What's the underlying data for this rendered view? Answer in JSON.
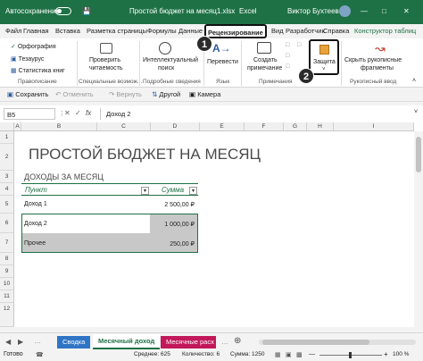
{
  "titlebar": {
    "autosave": "Автосохранение",
    "filename": "Простой бюджет на месяц1.xlsx",
    "app": "Excel",
    "user": "Виктор Бухтеев"
  },
  "tabs": [
    "Файл",
    "Главная",
    "Вставка",
    "Разметка страницы",
    "Формулы",
    "Данные",
    "Рецензирование",
    "Вид",
    "Разработчик",
    "Справка",
    "Конструктор таблиц"
  ],
  "ribbon": {
    "spelling": "Орфография",
    "thesaurus": "Тезаурус",
    "stats": "Статистика книг",
    "group_proofing": "Правописание",
    "check_access_1": "Проверить",
    "check_access_2": "читаемость",
    "group_access": "Специальные возмож...",
    "smart_lookup_1": "Интеллектуальный",
    "smart_lookup_2": "поиск",
    "group_insights": "Подробные сведения",
    "translate": "Перевести",
    "group_language": "Язык",
    "new_comment_1": "Создать",
    "new_comment_2": "примечание",
    "group_comments": "Примечания",
    "protect": "Защита",
    "hide_ink_1": "Скрыть рукописные",
    "hide_ink_2": "фрагменты",
    "group_ink": "Рукописный ввод"
  },
  "quick_access": {
    "save": "Сохранить",
    "undo": "Отменить",
    "redo": "Вернуть",
    "sort": "Другой",
    "camera": "Камера"
  },
  "formula_bar": {
    "name_box": "B5",
    "fx": "fx",
    "content": "Доход 2"
  },
  "columns": [
    "A",
    "B",
    "C",
    "D",
    "E",
    "F",
    "G",
    "H",
    "I"
  ],
  "rows": [
    "1",
    "2",
    "3",
    "4",
    "5",
    "6",
    "7",
    "8",
    "9",
    "10",
    "11",
    "12"
  ],
  "sheet": {
    "title": "ПРОСТОЙ БЮДЖЕТ НА МЕСЯЦ",
    "subtitle": "ДОХОДЫ ЗА МЕСЯЦ",
    "header_item": "Пункт",
    "header_amount": "Сумма",
    "income": [
      {
        "name": "Доход 1",
        "amount": "2 500,00 ₽"
      },
      {
        "name": "Доход 2",
        "amount": "1 000,00 ₽"
      },
      {
        "name": "Прочее",
        "amount": "250,00 ₽"
      }
    ]
  },
  "sheet_tabs": [
    "Сводка",
    "Месячный доход",
    "Месячные расх"
  ],
  "status": {
    "ready": "Готово",
    "average": "Среднее: 625",
    "count": "Количество: 6",
    "sum": "Сумма: 1250",
    "zoom": "100 %"
  },
  "annotations": {
    "step1": "1",
    "step2": "2"
  },
  "colors": {
    "excel_green": "#1e7145",
    "selection": "#c8c8c8",
    "table_header": "#1e7145"
  }
}
